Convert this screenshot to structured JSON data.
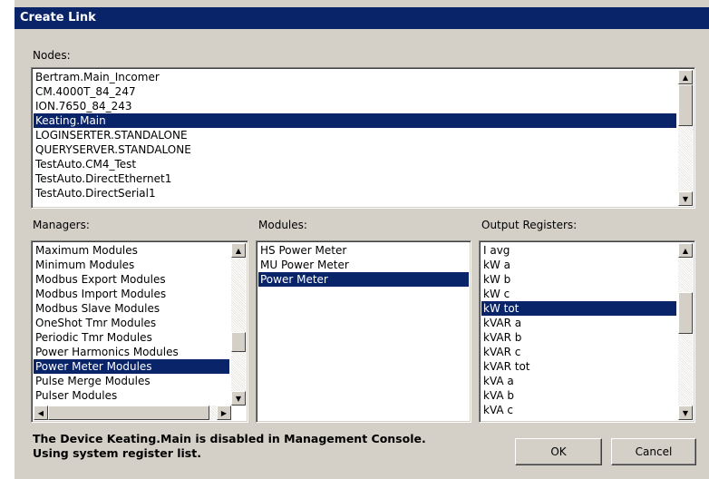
{
  "window": {
    "title": "Create Link"
  },
  "nodes": {
    "label": "Nodes:",
    "items": [
      "Bertram.Main_Incomer",
      "CM.4000T_84_247",
      "ION.7650_84_243",
      "Keating.Main",
      "LOGINSERTER.STANDALONE",
      "QUERYSERVER.STANDALONE",
      "TestAuto.CM4_Test",
      "TestAuto.DirectEthernet1",
      "TestAuto.DirectSerial1"
    ],
    "selected": "Keating.Main"
  },
  "managers": {
    "label": "Managers:",
    "items": [
      "Maximum Modules",
      "Minimum Modules",
      "Modbus Export Modules",
      "Modbus Import Modules",
      "Modbus Slave Modules",
      "OneShot Tmr Modules",
      "Periodic Tmr Modules",
      "Power Harmonics Modules",
      "Power Meter Modules",
      "Pulse Merge Modules",
      "Pulser Modules"
    ],
    "selected": "Power Meter Modules"
  },
  "modules": {
    "label": "Modules:",
    "items": [
      "HS Power Meter",
      "MU Power Meter",
      "Power Meter"
    ],
    "selected": "Power Meter"
  },
  "output_registers": {
    "label": "Output Registers:",
    "items": [
      "I avg",
      "kW a",
      "kW b",
      "kW c",
      "kW tot",
      "kVAR a",
      "kVAR b",
      "kVAR c",
      "kVAR tot",
      "kVA a",
      "kVA b",
      "kVA c"
    ],
    "selected": "kW tot"
  },
  "message": {
    "line1": "The Device Keating.Main is disabled in Management Console.",
    "line2": "Using system register list."
  },
  "buttons": {
    "ok": "OK",
    "cancel": "Cancel"
  },
  "icons": {
    "up": "scroll-up-arrow-icon",
    "down": "scroll-down-arrow-icon",
    "left": "scroll-left-arrow-icon",
    "right": "scroll-right-arrow-icon"
  }
}
